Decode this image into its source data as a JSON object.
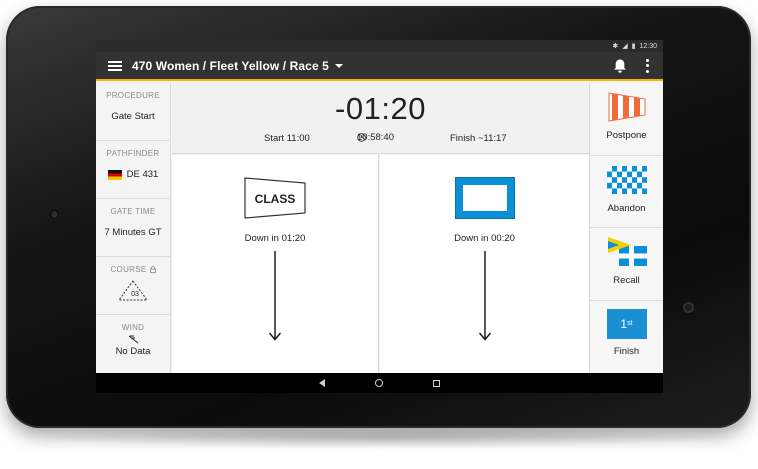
{
  "statusbar": {
    "time": "12:30",
    "icons": [
      "bluetooth-icon",
      "signal-icon",
      "battery-icon"
    ]
  },
  "toolbar": {
    "title": "470 Women / Fleet Yellow / Race 5"
  },
  "left_panel": {
    "procedure": {
      "label": "PROCEDURE",
      "value": "Gate Start"
    },
    "pathfinder": {
      "label": "PATHFINDER",
      "value": "DE 431"
    },
    "gate_time": {
      "label": "GATE TIME",
      "value": "7 Minutes GT"
    },
    "course": {
      "label": "COURSE",
      "value": "03"
    },
    "wind": {
      "label": "WIND",
      "value": "No Data"
    }
  },
  "timer": {
    "countdown": "-01:20",
    "start": "Start 11:00",
    "clock": "10:58:40",
    "finish": "Finish ~11:17"
  },
  "flags": {
    "left": {
      "flag_text": "CLASS",
      "down": "Down in 01:20"
    },
    "right": {
      "down": "Down in 00:20"
    }
  },
  "actions": {
    "postpone": "Postpone",
    "abandon": "Abandon",
    "recall": "Recall",
    "finish": "Finish",
    "finish_flag_num": "1",
    "finish_flag_sup": "st"
  },
  "colors": {
    "toolbar_bg": "#323232",
    "accent": "#f5b400",
    "blue_flag": "#0b8fd6",
    "postpone_red": "#f06a3a"
  }
}
